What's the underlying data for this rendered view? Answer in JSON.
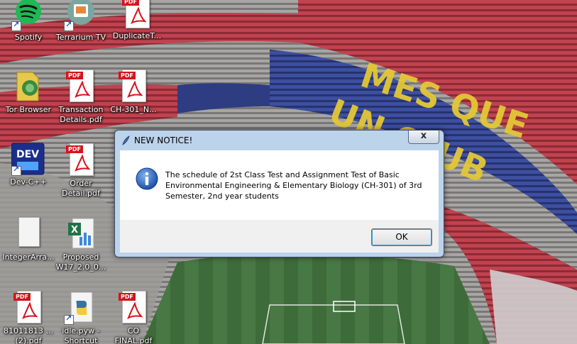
{
  "desktop": {
    "icons": [
      {
        "label": "Spotify",
        "icon": "spotify-icon"
      },
      {
        "label": "Terrarium TV",
        "icon": "terrarium-tv-icon"
      },
      {
        "label": "DuplicateT...",
        "icon": "pdf-icon"
      },
      {
        "label": "Tor Browser",
        "icon": "tor-browser-icon"
      },
      {
        "label": "Transaction\nDetails.pdf",
        "icon": "pdf-icon"
      },
      {
        "label": "CH-301_N...",
        "icon": "pdf-icon"
      },
      {
        "label": "Dev-C++",
        "icon": "devcpp-icon"
      },
      {
        "label": "Order\nDetail.pdf",
        "icon": "pdf-icon"
      },
      {
        "label": "IntegerArra...",
        "icon": "document-icon"
      },
      {
        "label": "Proposed\nW17_2.0_0...",
        "icon": "excel-icon"
      },
      {
        "label": "81011813 ...\n(2).pdf",
        "icon": "pdf-icon"
      },
      {
        "label": "idle.pyw -\nShortcut",
        "icon": "python-icon"
      },
      {
        "label": "CO\nFINAL.pdf",
        "icon": "pdf-icon"
      }
    ],
    "pdf_tag": "PDF",
    "devcpp_text": "DEV",
    "wallpaper_colors": {
      "seats_red": "#c0434f",
      "seats_blue": "#3d4fa0",
      "seats_yellow": "#e4c836",
      "pitch": "#3e6b3a"
    }
  },
  "dialog": {
    "title": "NEW NOTICE!",
    "close_label": "x",
    "message": "The schedule of 2st Class Test and Assignment Test of Basic Environmental Engineering & Elementary Biology (CH-301) of 3rd Semester, 2nd year students",
    "ok_label": "OK",
    "accent_color": "#2d5fb8"
  }
}
